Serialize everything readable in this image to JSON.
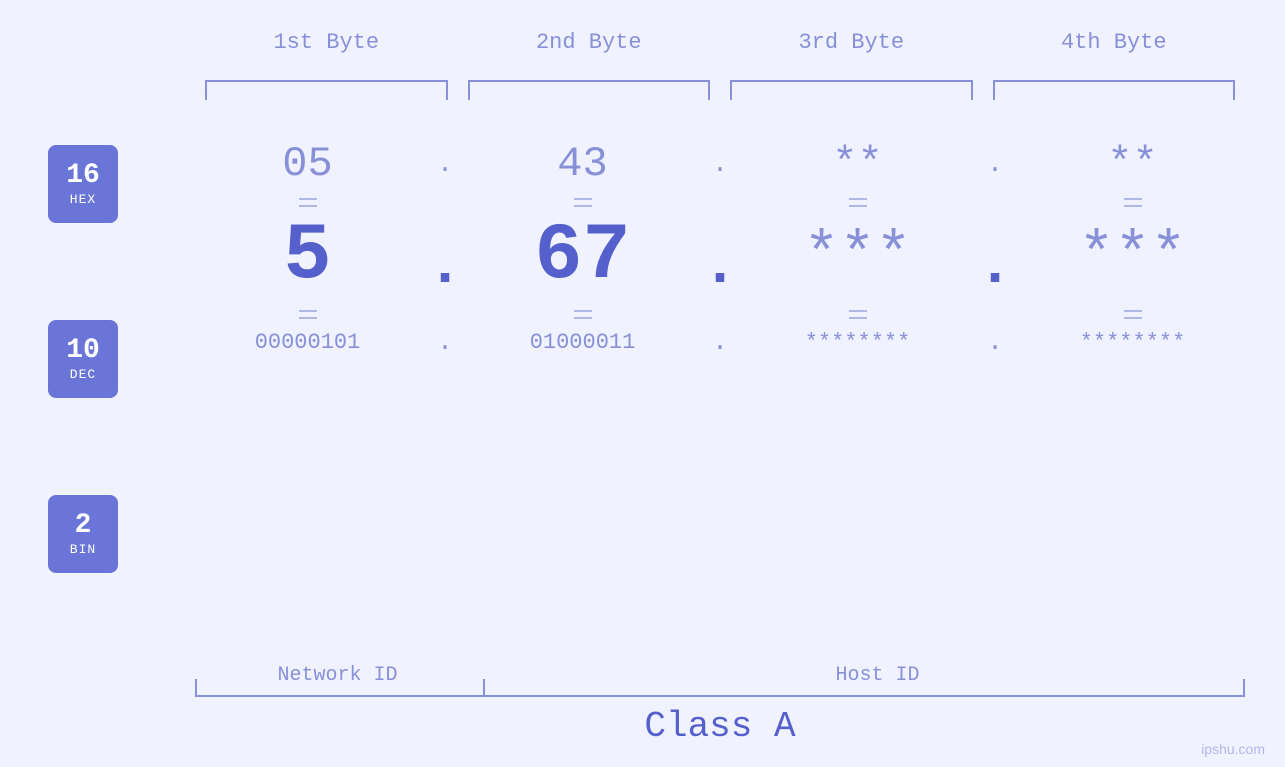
{
  "page": {
    "background_color": "#f0f2ff",
    "accent_color": "#6b75d8",
    "text_color_dark": "#5560cc",
    "text_color_light": "#8890d8"
  },
  "badges": [
    {
      "id": "hex-badge",
      "number": "16",
      "label": "HEX"
    },
    {
      "id": "dec-badge",
      "number": "10",
      "label": "DEC"
    },
    {
      "id": "bin-badge",
      "number": "2",
      "label": "BIN"
    }
  ],
  "column_headers": [
    {
      "id": "col1",
      "label": "1st Byte"
    },
    {
      "id": "col2",
      "label": "2nd Byte"
    },
    {
      "id": "col3",
      "label": "3rd Byte"
    },
    {
      "id": "col4",
      "label": "4th Byte"
    }
  ],
  "hex_row": {
    "byte1": "05",
    "byte2": "43",
    "byte3": "**",
    "byte4": "**",
    "sep": "."
  },
  "dec_row": {
    "byte1": "5",
    "byte2": "67",
    "byte3": "***",
    "byte4": "***",
    "sep": "."
  },
  "bin_row": {
    "byte1": "00000101",
    "byte2": "01000011",
    "byte3": "********",
    "byte4": "********",
    "sep": "."
  },
  "labels": {
    "network_id": "Network ID",
    "host_id": "Host ID",
    "class": "Class A"
  },
  "watermark": "ipshu.com"
}
